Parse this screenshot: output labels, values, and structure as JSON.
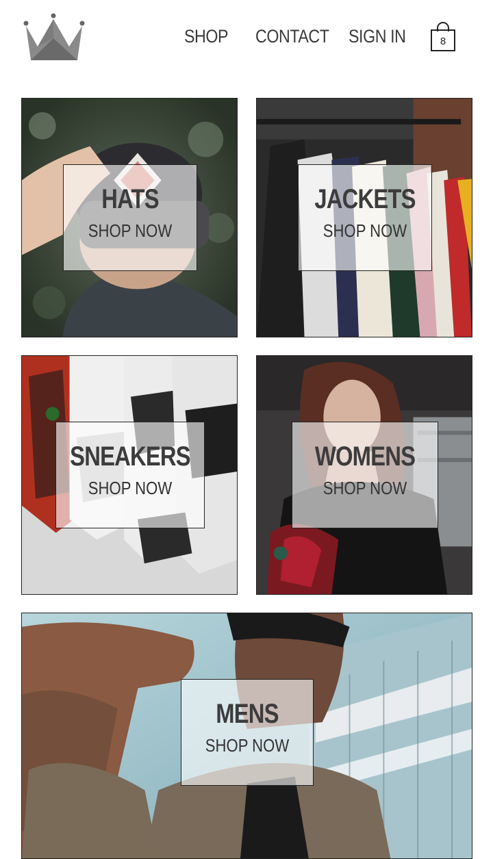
{
  "header": {
    "logo_icon": "crown-icon",
    "nav": [
      {
        "label": "SHOP"
      },
      {
        "label": "CONTACT"
      },
      {
        "label": "SIGN IN"
      }
    ],
    "cart": {
      "icon": "shopping-bag-icon",
      "count": "8"
    }
  },
  "categories": [
    {
      "title": "HATS",
      "cta": "SHOP NOW"
    },
    {
      "title": "JACKETS",
      "cta": "SHOP NOW"
    },
    {
      "title": "SNEAKERS",
      "cta": "SHOP NOW"
    },
    {
      "title": "WOMENS",
      "cta": "SHOP NOW"
    },
    {
      "title": "MENS",
      "cta": "SHOP NOW"
    }
  ],
  "colors": {
    "text": "#333333",
    "border": "#222222",
    "overlay": "#ffffffa0"
  }
}
